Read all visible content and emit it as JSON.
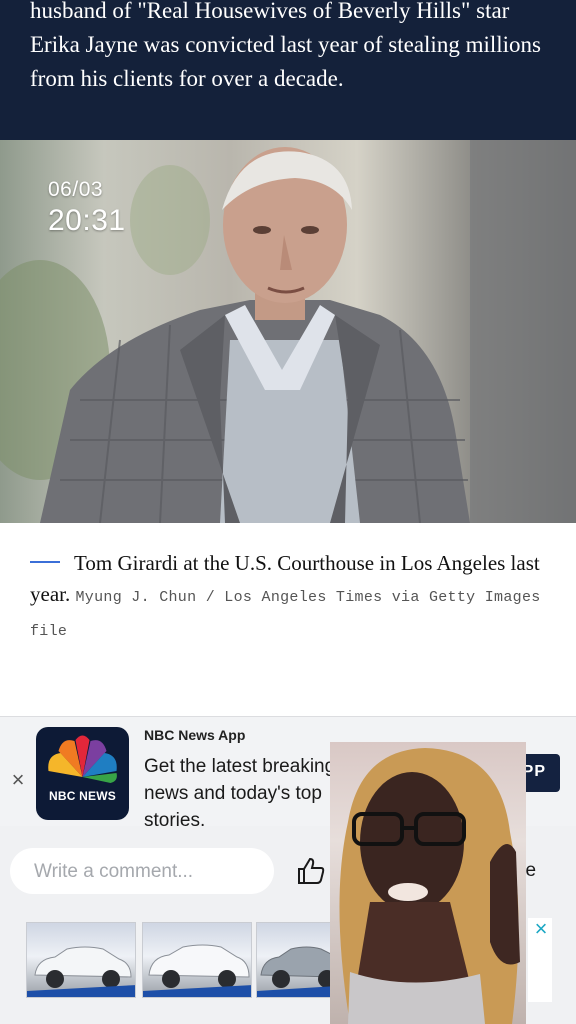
{
  "article": {
    "summary": "husband of \"Real Housewives of Beverly Hills\" star Erika Jayne was convicted last year of stealing millions from his clients for over a decade.",
    "photo_timestamp": {
      "date": "06/03",
      "time": "20:31"
    },
    "caption": "Tom Girardi at the U.S. Courthouse in Los Angeles last year.",
    "credit": "Myung J. Chun / Los Angeles Times via Getty Images file"
  },
  "promo": {
    "app_name": "NBC News App",
    "description": "Get the latest breaking news and today's top stories.",
    "logo_text": "NBC NEWS",
    "cta": "W IN APP",
    "close": "×"
  },
  "comments": {
    "placeholder": "Write a comment...",
    "share_label": "hare"
  },
  "ad": {
    "close": "×"
  },
  "icons": {
    "like": "thumbs-up-icon",
    "close": "close-icon",
    "logo": "nbc-peacock-icon"
  },
  "colors": {
    "navy": "#14213a",
    "accent_blue": "#3b6fd8",
    "cta_bg": "#142240",
    "ad_close": "#1ba7c4"
  }
}
